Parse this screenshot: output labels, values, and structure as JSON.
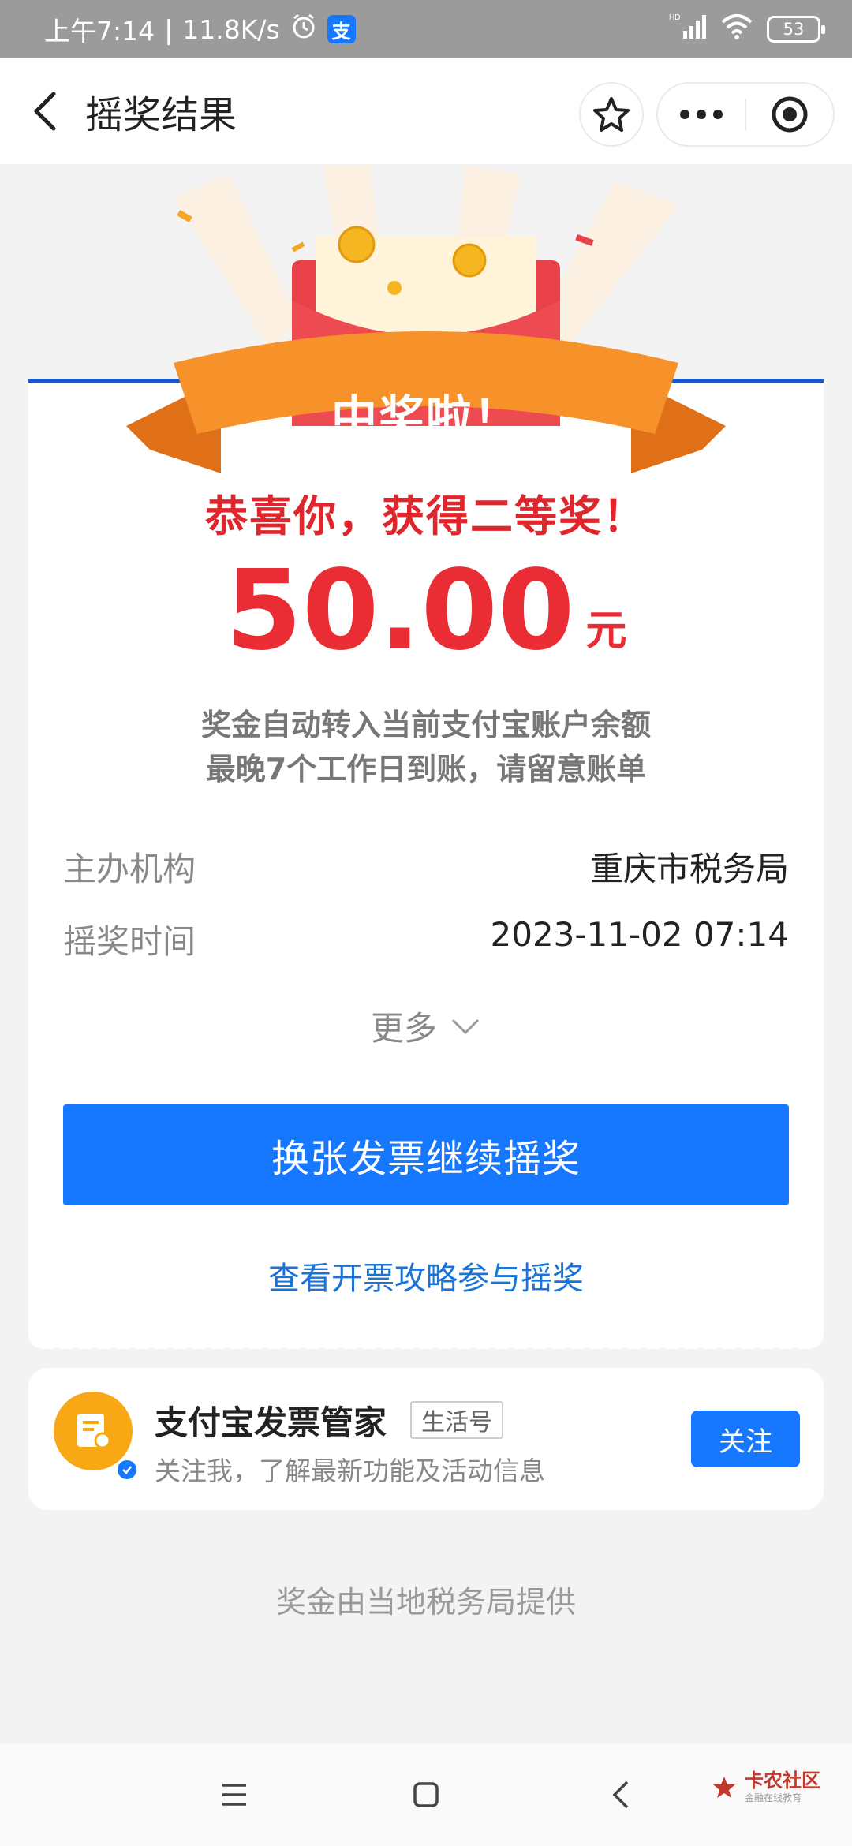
{
  "status_bar": {
    "time": "上午7:14",
    "speed": "11.8K/s",
    "battery": "53",
    "hd_label": "HD"
  },
  "nav": {
    "title": "摇奖结果"
  },
  "prize": {
    "ribbon": "中奖啦！",
    "congrats": "恭喜你，获得二等奖！",
    "amount": "50.00",
    "unit": "元",
    "note_line1": "奖金自动转入当前支付宝账户余额",
    "note_line2": "最晚7个工作日到账，请留意账单"
  },
  "details": {
    "organizer_label": "主办机构",
    "organizer_value": "重庆市税务局",
    "time_label": "摇奖时间",
    "time_value": "2023-11-02 07:14",
    "more_label": "更多"
  },
  "actions": {
    "primary_label": "换张发票继续摇奖",
    "guide_link": "查看开票攻略参与摇奖"
  },
  "follow": {
    "name": "支付宝发票管家",
    "tag": "生活号",
    "desc": "关注我，了解最新功能及活动信息",
    "button": "关注"
  },
  "footer": {
    "note": "奖金由当地税务局提供"
  },
  "watermark": {
    "text": "卡农社区",
    "sub": "金融在线教育"
  },
  "colors": {
    "accent_blue": "#1677ff",
    "prize_red": "#ea2d35",
    "ribbon_orange": "#f7922a"
  }
}
